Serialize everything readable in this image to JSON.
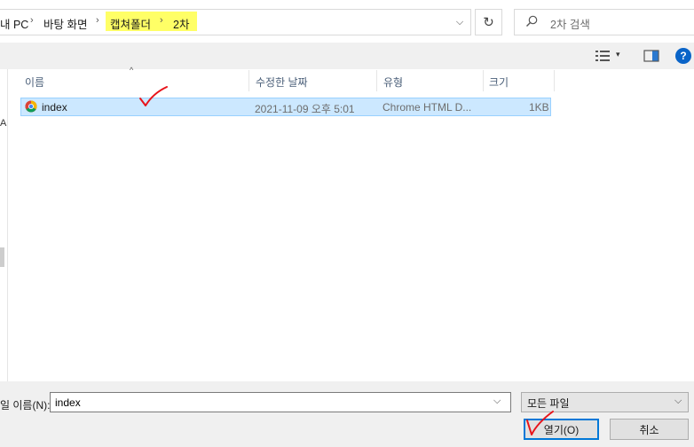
{
  "address": {
    "crumbs": [
      "내 PC",
      "바탕 화면",
      "캡쳐폴더",
      "2차"
    ],
    "separator": "›",
    "dropdown_glyph": "⌵",
    "refresh_glyph": "↻"
  },
  "search": {
    "placeholder": "2차 검색"
  },
  "toolbar": {
    "view_dropdown_glyph": "▾",
    "help_label": "?"
  },
  "navpane": {
    "partial_letter": "A"
  },
  "columns": {
    "name": "이름",
    "date": "수정한 날짜",
    "type": "유형",
    "size": "크기",
    "sort_glyph": "^"
  },
  "files": [
    {
      "name": "index",
      "date": "2021-11-09 오후 5:01",
      "type": "Chrome HTML D...",
      "size": "1KB",
      "icon": "chrome-icon",
      "selected": true
    }
  ],
  "filename": {
    "label": "일 이름(N):",
    "value": "index",
    "dropdown_glyph": "⌵"
  },
  "filetype": {
    "selected": "모든 파일",
    "dropdown_glyph": "⌵"
  },
  "buttons": {
    "open": "열기(O)",
    "cancel": "취소"
  },
  "colors": {
    "highlight": "#ffff66",
    "selection": "#cce8ff",
    "annotation_red": "#e8141b",
    "accent": "#0078d7"
  }
}
